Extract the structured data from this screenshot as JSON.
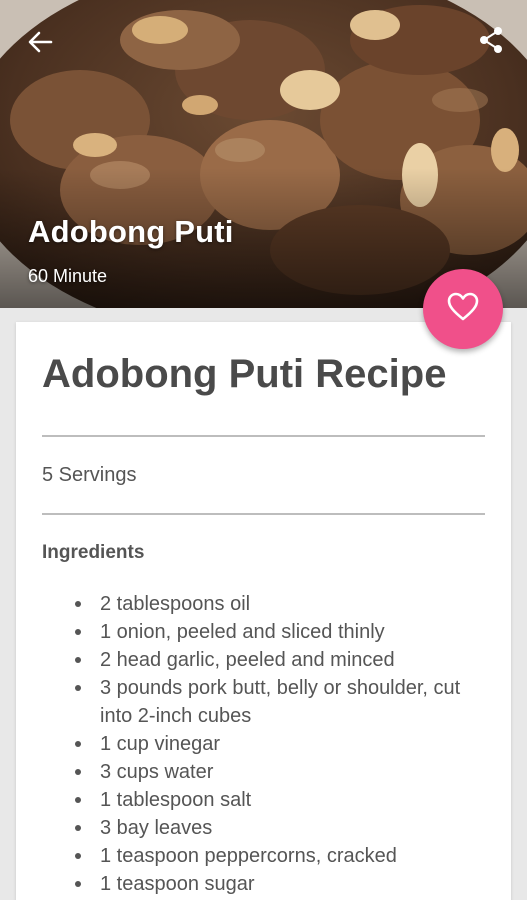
{
  "hero": {
    "title": "Adobong Puti",
    "duration": "60 Minute"
  },
  "icons": {
    "back": "arrow-left-icon",
    "share": "share-icon",
    "favorite": "heart-outline-icon"
  },
  "colors": {
    "fab": "#f0508a",
    "text": "#555555",
    "title": "#4a4a4a"
  },
  "recipe": {
    "title": "Adobong Puti Recipe",
    "servings": "5 Servings",
    "ingredients_heading": "Ingredients",
    "ingredients": [
      "2 tablespoons oil",
      "1 onion, peeled and sliced thinly",
      "2 head garlic, peeled and minced",
      "3 pounds pork butt, belly or shoulder, cut into 2-inch cubes",
      "1 cup vinegar",
      "3 cups water",
      "1 tablespoon salt",
      "3 bay leaves",
      "1 teaspoon peppercorns, cracked",
      "1 teaspoon sugar"
    ]
  }
}
